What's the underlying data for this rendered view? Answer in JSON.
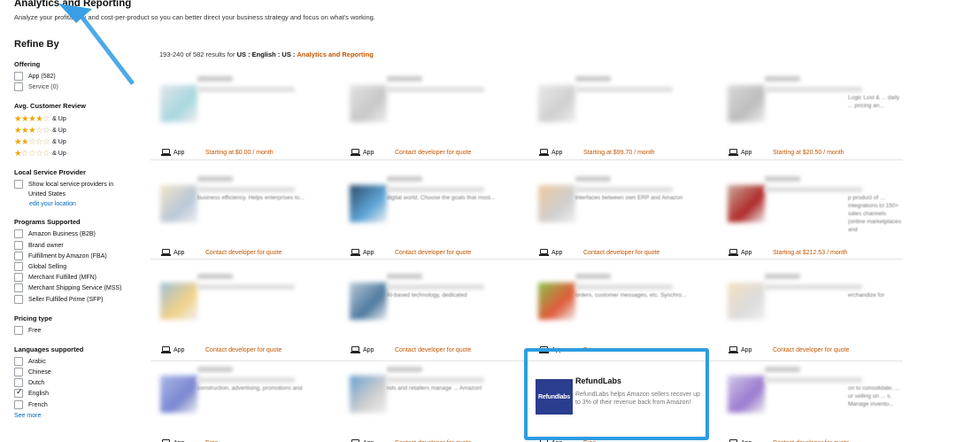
{
  "header": {
    "title": "Analytics and Reporting",
    "subtitle": "Analyze your profitability and cost-per-product so you can better direct your business strategy and focus on what's working."
  },
  "sidebar": {
    "refine_title": "Refine By",
    "offering": {
      "heading": "Offering",
      "items": [
        {
          "label": "App (582)"
        },
        {
          "label": "Service (0)"
        }
      ]
    },
    "reviews": {
      "heading": "Avg. Customer Review",
      "up_label": "& Up",
      "rows": [
        {
          "stars": 4
        },
        {
          "stars": 3
        },
        {
          "stars": 2
        },
        {
          "stars": 1
        }
      ]
    },
    "local": {
      "heading": "Local Service Provider",
      "show_label": "Show local service providers in United States",
      "edit_link": "edit your location"
    },
    "programs": {
      "heading": "Programs Supported",
      "items": [
        {
          "label": "Amazon Business (B2B)"
        },
        {
          "label": "Brand owner"
        },
        {
          "label": "Fulfillment by Amazon (FBA)"
        },
        {
          "label": "Global Selling"
        },
        {
          "label": "Merchant Fulfilled (MFN)"
        },
        {
          "label": "Merchant Shipping Service (MSS)"
        },
        {
          "label": "Seller Fulfilled Prime (SFP)"
        }
      ]
    },
    "pricing": {
      "heading": "Pricing type",
      "items": [
        {
          "label": "Free"
        }
      ]
    },
    "languages": {
      "heading": "Languages supported",
      "items": [
        {
          "label": "Arabic",
          "checked": false
        },
        {
          "label": "Chinese",
          "checked": false
        },
        {
          "label": "Dutch",
          "checked": false
        },
        {
          "label": "English",
          "checked": true
        },
        {
          "label": "French",
          "checked": false
        }
      ],
      "see_more": "See more"
    }
  },
  "results": {
    "count_text": "193-240 of 582 results for",
    "filters": "US : English : US :",
    "category": "Analytics and Reporting"
  },
  "cards": [
    {
      "type_label": "App",
      "price": "Starting at $0.00 / month",
      "snippet": ""
    },
    {
      "type_label": "App",
      "price": "Contact developer for quote",
      "snippet": ""
    },
    {
      "type_label": "App",
      "price": "Starting at $99.70 / month",
      "snippet": ""
    },
    {
      "type_label": "App",
      "price": "Starting at $20.50 / month",
      "snippet": "Logic Lost & ... daily ... pricing an..."
    },
    {
      "type_label": "App",
      "price": "Contact developer for quote",
      "snippet": "business efficiency. Helps enterprises to..."
    },
    {
      "type_label": "App",
      "price": "Contact developer for quote",
      "snippet": "digital world. Choose the goals that most..."
    },
    {
      "type_label": "App",
      "price": "Contact developer for quote",
      "snippet": "interfaces between own ERP and Amazon"
    },
    {
      "type_label": "App",
      "price": "Starting at $212.53 / month",
      "snippet": "p product of ... integrations to 150+ sales channels (online marketplaces and"
    },
    {
      "type_label": "App",
      "price": "Contact developer for quote",
      "snippet": ""
    },
    {
      "type_label": "App",
      "price": "Contact developer for quote",
      "snippet": "AI-based technology, dedicated"
    },
    {
      "type_label": "App",
      "price": "Free",
      "snippet": "orders, customer messages, etc. Synchro..."
    },
    {
      "type_label": "App",
      "price": "Contact developer for quote",
      "snippet": "erchandize for"
    },
    {
      "type_label": "App",
      "price": "Free",
      "snippet": "construction, advertising, promotions and"
    },
    {
      "type_label": "App",
      "price": "Contact developer for quote",
      "snippet": "nds and retailers manage ... Amazon!"
    },
    {
      "type_label": "App",
      "price": "Free",
      "snippet": ""
    },
    {
      "type_label": "App",
      "price": "Contact developer for quote",
      "snippet": "on to consolidate, ... ur selling on ... s. Manage invento..."
    }
  ],
  "featured": {
    "name": "RefundLabs",
    "logo_text": "Refundlabs",
    "description": "RefundLabs helps Amazon sellers recover up to 3% of their revenue back from Amazon!"
  },
  "colors": {
    "accent": "#c45500",
    "highlight": "#2f9de0",
    "link": "#0066c0"
  }
}
